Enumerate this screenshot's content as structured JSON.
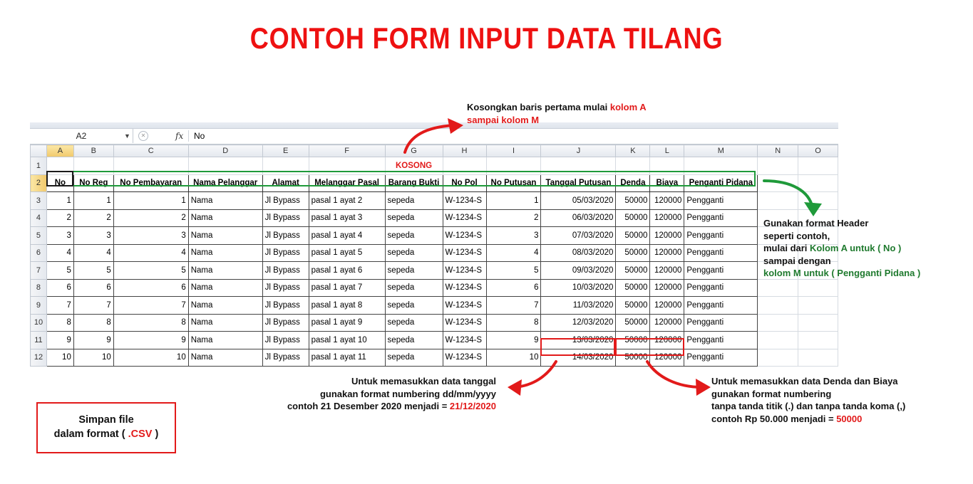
{
  "title": "CONTOH FORM INPUT DATA TILANG",
  "formula_bar": {
    "cell_ref": "A2",
    "value": "No",
    "fx_label": "fx"
  },
  "kosong_label": "KOSONG",
  "columns": [
    "A",
    "B",
    "C",
    "D",
    "E",
    "F",
    "G",
    "H",
    "I",
    "J",
    "K",
    "L",
    "M",
    "N",
    "O"
  ],
  "row_numbers": [
    "1",
    "2",
    "3",
    "4",
    "5",
    "6",
    "7",
    "8",
    "9",
    "10",
    "11",
    "12"
  ],
  "headers": [
    "No",
    "No Reg",
    "No Pembayaran",
    "Nama Pelanggar",
    "Alamat",
    "Melanggar Pasal",
    "Barang Bukti",
    "No Pol",
    "No Putusan",
    "Tanggal Putusan",
    "Denda",
    "Biaya",
    "Penganti Pidana"
  ],
  "rows": [
    [
      "1",
      "1",
      "1",
      "Nama",
      "Jl Bypass",
      "pasal 1 ayat 2",
      "sepeda",
      "W-1234-S",
      "1",
      "05/03/2020",
      "50000",
      "120000",
      "Pengganti"
    ],
    [
      "2",
      "2",
      "2",
      "Nama",
      "Jl Bypass",
      "pasal 1 ayat 3",
      "sepeda",
      "W-1234-S",
      "2",
      "06/03/2020",
      "50000",
      "120000",
      "Pengganti"
    ],
    [
      "3",
      "3",
      "3",
      "Nama",
      "Jl Bypass",
      "pasal 1 ayat 4",
      "sepeda",
      "W-1234-S",
      "3",
      "07/03/2020",
      "50000",
      "120000",
      "Pengganti"
    ],
    [
      "4",
      "4",
      "4",
      "Nama",
      "Jl Bypass",
      "pasal 1 ayat 5",
      "sepeda",
      "W-1234-S",
      "4",
      "08/03/2020",
      "50000",
      "120000",
      "Pengganti"
    ],
    [
      "5",
      "5",
      "5",
      "Nama",
      "Jl Bypass",
      "pasal 1 ayat 6",
      "sepeda",
      "W-1234-S",
      "5",
      "09/03/2020",
      "50000",
      "120000",
      "Pengganti"
    ],
    [
      "6",
      "6",
      "6",
      "Nama",
      "Jl Bypass",
      "pasal 1 ayat 7",
      "sepeda",
      "W-1234-S",
      "6",
      "10/03/2020",
      "50000",
      "120000",
      "Pengganti"
    ],
    [
      "7",
      "7",
      "7",
      "Nama",
      "Jl Bypass",
      "pasal 1 ayat 8",
      "sepeda",
      "W-1234-S",
      "7",
      "11/03/2020",
      "50000",
      "120000",
      "Pengganti"
    ],
    [
      "8",
      "8",
      "8",
      "Nama",
      "Jl Bypass",
      "pasal 1 ayat 9",
      "sepeda",
      "W-1234-S",
      "8",
      "12/03/2020",
      "50000",
      "120000",
      "Pengganti"
    ],
    [
      "9",
      "9",
      "9",
      "Nama",
      "Jl Bypass",
      "pasal 1 ayat 10",
      "sepeda",
      "W-1234-S",
      "9",
      "13/03/2020",
      "50000",
      "120000",
      "Pengganti"
    ],
    [
      "10",
      "10",
      "10",
      "Nama",
      "Jl Bypass",
      "pasal 1 ayat 11",
      "sepeda",
      "W-1234-S",
      "10",
      "14/03/2020",
      "50000",
      "120000",
      "Pengganti"
    ]
  ],
  "note_top": {
    "l1_a": "Kosongkan baris pertama mulai ",
    "l1_b": "kolom A",
    "l2": "sampai kolom M"
  },
  "note_header": {
    "l1": "Gunakan format Header",
    "l2": "seperti contoh,",
    "l3_a": "mulai dari ",
    "l3_b": "Kolom A untuk ( No )",
    "l4": "sampai dengan",
    "l5": "kolom M untuk ( Pengganti Pidana )"
  },
  "note_date": {
    "l1": "Untuk memasukkan data tanggal",
    "l2": "gunakan format numbering dd/mm/yyyy",
    "l3_a": "contoh 21 Desember 2020 menjadi = ",
    "l3_b": "21/12/2020"
  },
  "note_denda": {
    "l1": "Untuk memasukkan data Denda dan Biaya",
    "l2": "gunakan format numbering",
    "l3": "tanpa tanda titik (.) dan tanpa tanda koma (,)",
    "l4_a": "contoh Rp 50.000 menjadi = ",
    "l4_b": "50000"
  },
  "csv_box": {
    "l1": "Simpan file",
    "l2_a": "dalam format ( ",
    "l2_b": ".CSV",
    "l2_c": " )"
  },
  "colors": {
    "title": "#ee1111",
    "header_outline": "#1f9a3a",
    "highlight_red": "#e21a1a",
    "green_text": "#1f7a2e"
  }
}
